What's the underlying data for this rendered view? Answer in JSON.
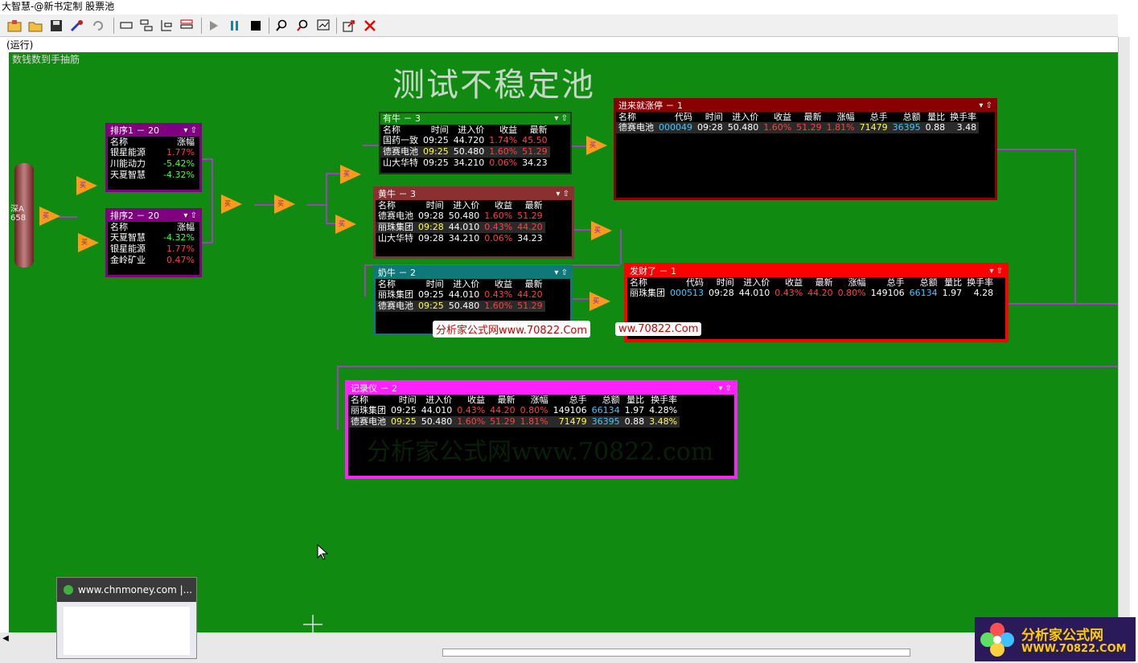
{
  "window": {
    "title": "大智慧-@新书定制 股票池"
  },
  "status": {
    "run": "(运行)"
  },
  "canvas": {
    "subtitle": "数钱数到手抽筋",
    "title": "测试不稳定池",
    "bg_color": "#108a10"
  },
  "source": {
    "label_line1": "深A",
    "label_line2": "658"
  },
  "panels": {
    "sort1": {
      "title": "排序1 － 20",
      "headers": [
        "名称",
        "涨幅"
      ],
      "rows": [
        [
          "银星能源",
          "1.77%"
        ],
        [
          "川能动力",
          "-5.42%"
        ],
        [
          "天夏智慧",
          "-4.32%"
        ]
      ]
    },
    "sort2": {
      "title": "排序2 － 20",
      "headers": [
        "名称",
        "涨幅"
      ],
      "rows": [
        [
          "天夏智慧",
          "-4.32%"
        ],
        [
          "银星能源",
          "1.77%"
        ],
        [
          "金岭矿业",
          "0.47%"
        ]
      ]
    },
    "youniu": {
      "title": "有牛 － 3",
      "headers": [
        "名称",
        "时间",
        "进入价",
        "收益",
        "最新"
      ],
      "rows": [
        [
          "国药一致",
          "09:25",
          "44.720",
          "1.74%",
          "45.50"
        ],
        [
          "德赛电池",
          "09:25",
          "50.480",
          "1.60%",
          "51.29"
        ],
        [
          "山大华特",
          "09:25",
          "34.210",
          "0.06%",
          "34.23"
        ]
      ]
    },
    "huangniu": {
      "title": "黄牛 － 3",
      "headers": [
        "名称",
        "时间",
        "进入价",
        "收益",
        "最新"
      ],
      "rows": [
        [
          "德赛电池",
          "09:28",
          "50.480",
          "1.60%",
          "51.29"
        ],
        [
          "丽珠集团",
          "09:28",
          "44.010",
          "0.43%",
          "44.20"
        ],
        [
          "山大华特",
          "09:28",
          "34.210",
          "0.06%",
          "34.23"
        ]
      ]
    },
    "nainiu": {
      "title": "奶牛 － 2",
      "headers": [
        "名称",
        "时间",
        "进入价",
        "收益",
        "最新"
      ],
      "rows": [
        [
          "丽珠集团",
          "09:25",
          "44.010",
          "0.43%",
          "44.20"
        ],
        [
          "德赛电池",
          "09:25",
          "50.480",
          "1.60%",
          "51.29"
        ]
      ]
    },
    "jinlai": {
      "title": "进来就涨停 － 1",
      "headers": [
        "名称",
        "代码",
        "时间",
        "进入价",
        "收益",
        "最新",
        "涨幅",
        "总手",
        "总额",
        "量比",
        "换手率"
      ],
      "rows": [
        [
          "德赛电池",
          "000049",
          "09:28",
          "50.480",
          "1.60%",
          "51.29",
          "1.81%",
          "71479",
          "36395",
          "0.88",
          "3.48"
        ]
      ]
    },
    "facai": {
      "title": "发财了 － 1",
      "headers": [
        "名称",
        "代码",
        "时间",
        "进入价",
        "收益",
        "最新",
        "涨幅",
        "总手",
        "总额",
        "量比",
        "换手率"
      ],
      "rows": [
        [
          "丽珠集团",
          "000513",
          "09:28",
          "44.010",
          "0.43%",
          "44.20",
          "0.80%",
          "149106",
          "66134",
          "1.97",
          "4.28"
        ]
      ]
    },
    "jilu": {
      "title": "记录仪 － 2",
      "headers": [
        "名称",
        "时间",
        "进入价",
        "收益",
        "最新",
        "涨幅",
        "总手",
        "总额",
        "量比",
        "换手率"
      ],
      "rows": [
        [
          "丽珠集团",
          "09:25",
          "44.010",
          "0.43%",
          "44.20",
          "0.80%",
          "149106",
          "66134",
          "1.97",
          "4.28%"
        ],
        [
          "德赛电池",
          "09:25",
          "50.480",
          "1.60%",
          "51.29",
          "1.81%",
          "71479",
          "36395",
          "0.88",
          "3.48%"
        ]
      ]
    }
  },
  "node_label": "买",
  "watermarks": {
    "stamp1": "分析家公式网www.70822.Com",
    "stamp2": "ww.70822.Com",
    "faint": "分析家公式网www.70822.com"
  },
  "popup": {
    "title": "www.chnmoney.com |..."
  },
  "logo": {
    "line1": "分析家公式网",
    "line2": "WWW.70822.COM"
  },
  "colors": {
    "sort_panel": "#800080",
    "youniu_panel": "#000000",
    "huangniu_panel": "#8a3030",
    "nainiu_panel": "#107878",
    "jinlai_panel": "#8a0000",
    "facai_panel": "#ff0000",
    "jilu_panel": "#ff20ff"
  }
}
